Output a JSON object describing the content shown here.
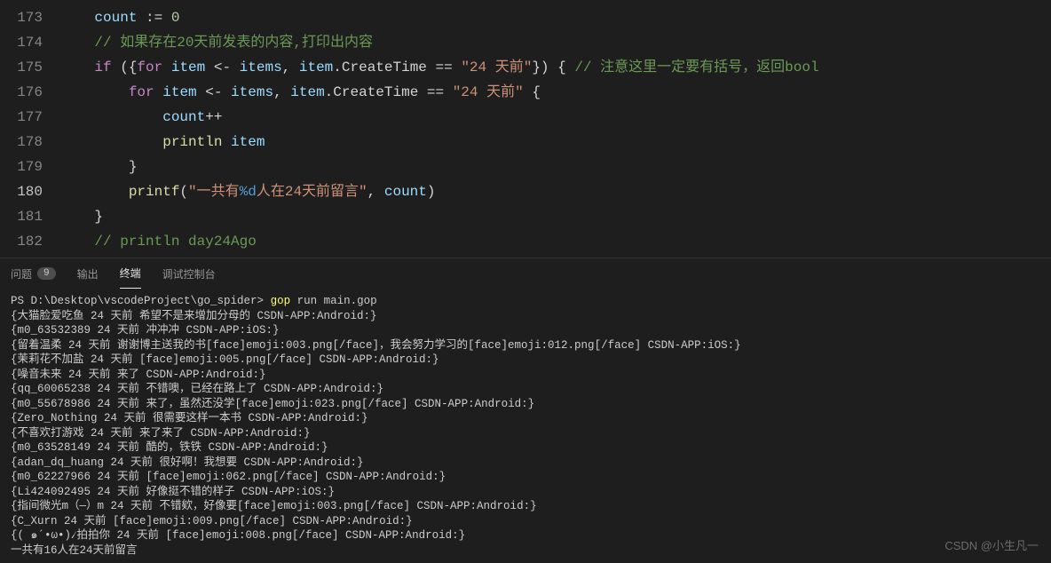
{
  "editor": {
    "lines": [
      {
        "num": "173",
        "tokens": [
          {
            "cls": "op",
            "t": "    "
          },
          {
            "cls": "var",
            "t": "count"
          },
          {
            "cls": "op",
            "t": " := "
          },
          {
            "cls": "num",
            "t": "0"
          }
        ]
      },
      {
        "num": "174",
        "tokens": [
          {
            "cls": "op",
            "t": "    "
          },
          {
            "cls": "cmt",
            "t": "// 如果存在20天前发表的内容,打印出内容"
          }
        ]
      },
      {
        "num": "175",
        "tokens": [
          {
            "cls": "op",
            "t": "    "
          },
          {
            "cls": "kw",
            "t": "if"
          },
          {
            "cls": "op",
            "t": " ({"
          },
          {
            "cls": "kw",
            "t": "for"
          },
          {
            "cls": "op",
            "t": " "
          },
          {
            "cls": "var",
            "t": "item"
          },
          {
            "cls": "op",
            "t": " <- "
          },
          {
            "cls": "var",
            "t": "items"
          },
          {
            "cls": "op",
            "t": ", "
          },
          {
            "cls": "var",
            "t": "item"
          },
          {
            "cls": "op",
            "t": "."
          },
          {
            "cls": "prop",
            "t": "CreateTime"
          },
          {
            "cls": "op",
            "t": " == "
          },
          {
            "cls": "str",
            "t": "\"24 天前\""
          },
          {
            "cls": "op",
            "t": "}) { "
          },
          {
            "cls": "cmt",
            "t": "// 注意这里一定要有括号，返回bool"
          }
        ]
      },
      {
        "num": "176",
        "tokens": [
          {
            "cls": "op",
            "t": "        "
          },
          {
            "cls": "kw",
            "t": "for"
          },
          {
            "cls": "op",
            "t": " "
          },
          {
            "cls": "var",
            "t": "item"
          },
          {
            "cls": "op",
            "t": " <- "
          },
          {
            "cls": "var",
            "t": "items"
          },
          {
            "cls": "op",
            "t": ", "
          },
          {
            "cls": "var",
            "t": "item"
          },
          {
            "cls": "op",
            "t": "."
          },
          {
            "cls": "prop",
            "t": "CreateTime"
          },
          {
            "cls": "op",
            "t": " == "
          },
          {
            "cls": "str",
            "t": "\"24 天前\""
          },
          {
            "cls": "op",
            "t": " {"
          }
        ]
      },
      {
        "num": "177",
        "tokens": [
          {
            "cls": "op",
            "t": "            "
          },
          {
            "cls": "var",
            "t": "count"
          },
          {
            "cls": "op",
            "t": "++"
          }
        ]
      },
      {
        "num": "178",
        "tokens": [
          {
            "cls": "op",
            "t": "            "
          },
          {
            "cls": "fn",
            "t": "println"
          },
          {
            "cls": "op",
            "t": " "
          },
          {
            "cls": "var",
            "t": "item"
          }
        ]
      },
      {
        "num": "179",
        "tokens": [
          {
            "cls": "op",
            "t": "        }"
          }
        ]
      },
      {
        "num": "180",
        "current": true,
        "tokens": [
          {
            "cls": "op",
            "t": "        "
          },
          {
            "cls": "fn",
            "t": "printf"
          },
          {
            "cls": "op",
            "t": "("
          },
          {
            "cls": "str",
            "t": "\"一共有"
          },
          {
            "cls": "fmt",
            "t": "%d"
          },
          {
            "cls": "str",
            "t": "人在24天前留言\""
          },
          {
            "cls": "op",
            "t": ", "
          },
          {
            "cls": "var",
            "t": "count"
          },
          {
            "cls": "op",
            "t": ")"
          }
        ]
      },
      {
        "num": "181",
        "tokens": [
          {
            "cls": "op",
            "t": "    }"
          }
        ]
      },
      {
        "num": "182",
        "tokens": [
          {
            "cls": "op",
            "t": "    "
          },
          {
            "cls": "cmt",
            "t": "// println day24Ago"
          }
        ]
      }
    ]
  },
  "tabs": {
    "problems": "问题",
    "problems_count": "9",
    "output": "输出",
    "terminal": "终端",
    "debug": "调试控制台"
  },
  "terminal": {
    "prompt": "PS D:\\Desktop\\vscodeProject\\go_spider> ",
    "cmd_gop": "gop",
    "cmd_rest": " run main.gop",
    "lines": [
      "{大猫脸爱吃鱼 24 天前 希望不是来增加分母的 CSDN-APP:Android:}",
      "{m0_63532389 24 天前 冲冲冲 CSDN-APP:iOS:}",
      "{留着温柔 24 天前 谢谢博主送我的书[face]emoji:003.png[/face]，我会努力学习的[face]emoji:012.png[/face] CSDN-APP:iOS:}",
      "{茉莉花不加盐 24 天前 [face]emoji:005.png[/face] CSDN-APP:Android:}",
      "{噪音未来 24 天前 来了 CSDN-APP:Android:}",
      "{qq_60065238 24 天前 不错噢，已经在路上了 CSDN-APP:Android:}",
      "{m0_55678986 24 天前 来了，虽然还没学[face]emoji:023.png[/face] CSDN-APP:Android:}",
      "{Zero_Nothing 24 天前 很需要这样一本书 CSDN-APP:Android:}",
      "{不喜欢打游戏 24 天前 来了来了 CSDN-APP:Android:}",
      "{m0_63528149 24 天前 酷的，铁铁 CSDN-APP:Android:}",
      "{adan_dq_huang 24 天前 很好啊！我想要 CSDN-APP:Android:}",
      "{m0_62227966 24 天前 [face]emoji:062.png[/face] CSDN-APP:Android:}",
      "{Li424092495 24 天前 好像挺不错的样子 CSDN-APP:iOS:}",
      "{指间微光m（—）m 24 天前 不错欸，好像要[face]emoji:003.png[/face] CSDN-APP:Android:}",
      "{C_Xurn 24 天前 [face]emoji:009.png[/face] CSDN-APP:Android:}",
      "{( ๑´•ω•)৴拍拍你 24 天前 [face]emoji:008.png[/face] CSDN-APP:Android:}",
      "一共有16人在24天前留言"
    ]
  },
  "watermark": "CSDN @小生凡一"
}
